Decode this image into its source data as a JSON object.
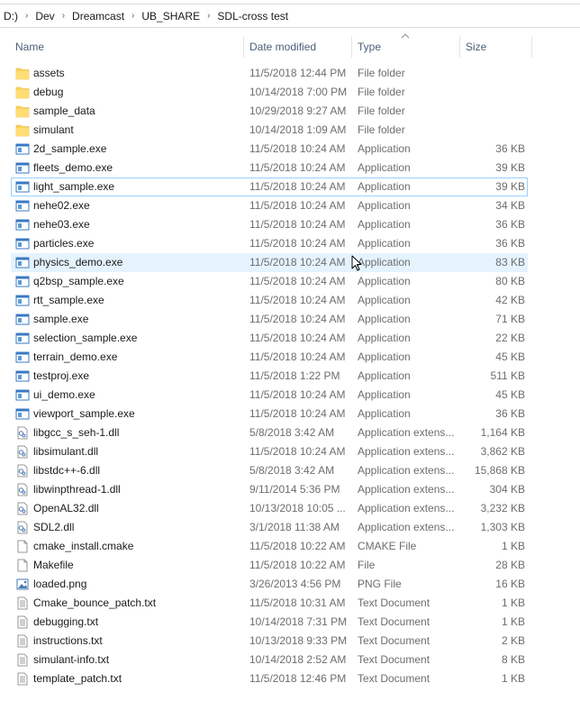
{
  "breadcrumb": [
    "D:)",
    "Dev",
    "Dreamcast",
    "UB_SHARE",
    "SDL-cross test"
  ],
  "columns": {
    "name": "Name",
    "date": "Date modified",
    "type": "Type",
    "size": "Size"
  },
  "sort": {
    "column": "type",
    "direction": "ascending"
  },
  "colors": {
    "folder": "#ffd35c",
    "header_text": "#4c607a",
    "hover_bg": "#e5f3ff",
    "focus_border": "#99d1ff"
  },
  "files": [
    {
      "name": "assets",
      "date": "11/5/2018 12:44 PM",
      "type": "File folder",
      "size": "",
      "icon": "folder-icon"
    },
    {
      "name": "debug",
      "date": "10/14/2018 7:00 PM",
      "type": "File folder",
      "size": "",
      "icon": "folder-icon"
    },
    {
      "name": "sample_data",
      "date": "10/29/2018 9:27 AM",
      "type": "File folder",
      "size": "",
      "icon": "folder-icon"
    },
    {
      "name": "simulant",
      "date": "10/14/2018 1:09 AM",
      "type": "File folder",
      "size": "",
      "icon": "folder-icon"
    },
    {
      "name": "2d_sample.exe",
      "date": "11/5/2018 10:24 AM",
      "type": "Application",
      "size": "36 KB",
      "icon": "application-icon"
    },
    {
      "name": "fleets_demo.exe",
      "date": "11/5/2018 10:24 AM",
      "type": "Application",
      "size": "39 KB",
      "icon": "application-icon"
    },
    {
      "name": "light_sample.exe",
      "date": "11/5/2018 10:24 AM",
      "type": "Application",
      "size": "39 KB",
      "icon": "application-icon",
      "state": "focused"
    },
    {
      "name": "nehe02.exe",
      "date": "11/5/2018 10:24 AM",
      "type": "Application",
      "size": "34 KB",
      "icon": "application-icon"
    },
    {
      "name": "nehe03.exe",
      "date": "11/5/2018 10:24 AM",
      "type": "Application",
      "size": "36 KB",
      "icon": "application-icon"
    },
    {
      "name": "particles.exe",
      "date": "11/5/2018 10:24 AM",
      "type": "Application",
      "size": "36 KB",
      "icon": "application-icon"
    },
    {
      "name": "physics_demo.exe",
      "date": "11/5/2018 10:24 AM",
      "type": "Application",
      "size": "83 KB",
      "icon": "application-icon",
      "state": "hovered"
    },
    {
      "name": "q2bsp_sample.exe",
      "date": "11/5/2018 10:24 AM",
      "type": "Application",
      "size": "80 KB",
      "icon": "application-icon"
    },
    {
      "name": "rtt_sample.exe",
      "date": "11/5/2018 10:24 AM",
      "type": "Application",
      "size": "42 KB",
      "icon": "application-icon"
    },
    {
      "name": "sample.exe",
      "date": "11/5/2018 10:24 AM",
      "type": "Application",
      "size": "71 KB",
      "icon": "application-icon"
    },
    {
      "name": "selection_sample.exe",
      "date": "11/5/2018 10:24 AM",
      "type": "Application",
      "size": "22 KB",
      "icon": "application-icon"
    },
    {
      "name": "terrain_demo.exe",
      "date": "11/5/2018 10:24 AM",
      "type": "Application",
      "size": "45 KB",
      "icon": "application-icon"
    },
    {
      "name": "testproj.exe",
      "date": "11/5/2018 1:22 PM",
      "type": "Application",
      "size": "511 KB",
      "icon": "application-icon"
    },
    {
      "name": "ui_demo.exe",
      "date": "11/5/2018 10:24 AM",
      "type": "Application",
      "size": "45 KB",
      "icon": "application-icon"
    },
    {
      "name": "viewport_sample.exe",
      "date": "11/5/2018 10:24 AM",
      "type": "Application",
      "size": "36 KB",
      "icon": "application-icon"
    },
    {
      "name": "libgcc_s_seh-1.dll",
      "date": "5/8/2018 3:42 AM",
      "type": "Application extens...",
      "size": "1,164 KB",
      "icon": "dll-icon"
    },
    {
      "name": "libsimulant.dll",
      "date": "11/5/2018 10:24 AM",
      "type": "Application extens...",
      "size": "3,862 KB",
      "icon": "dll-icon"
    },
    {
      "name": "libstdc++-6.dll",
      "date": "5/8/2018 3:42 AM",
      "type": "Application extens...",
      "size": "15,868 KB",
      "icon": "dll-icon"
    },
    {
      "name": "libwinpthread-1.dll",
      "date": "9/11/2014 5:36 PM",
      "type": "Application extens...",
      "size": "304 KB",
      "icon": "dll-icon"
    },
    {
      "name": "OpenAL32.dll",
      "date": "10/13/2018 10:05 ...",
      "type": "Application extens...",
      "size": "3,232 KB",
      "icon": "dll-icon"
    },
    {
      "name": "SDL2.dll",
      "date": "3/1/2018 11:38 AM",
      "type": "Application extens...",
      "size": "1,303 KB",
      "icon": "dll-icon"
    },
    {
      "name": "cmake_install.cmake",
      "date": "11/5/2018 10:22 AM",
      "type": "CMAKE File",
      "size": "1 KB",
      "icon": "blank-file-icon"
    },
    {
      "name": "Makefile",
      "date": "11/5/2018 10:22 AM",
      "type": "File",
      "size": "28 KB",
      "icon": "blank-file-icon"
    },
    {
      "name": "loaded.png",
      "date": "3/26/2013 4:56 PM",
      "type": "PNG File",
      "size": "16 KB",
      "icon": "image-file-icon"
    },
    {
      "name": "Cmake_bounce_patch.txt",
      "date": "11/5/2018 10:31 AM",
      "type": "Text Document",
      "size": "1 KB",
      "icon": "text-file-icon"
    },
    {
      "name": "debugging.txt",
      "date": "10/14/2018 7:31 PM",
      "type": "Text Document",
      "size": "1 KB",
      "icon": "text-file-icon"
    },
    {
      "name": "instructions.txt",
      "date": "10/13/2018 9:33 PM",
      "type": "Text Document",
      "size": "2 KB",
      "icon": "text-file-icon"
    },
    {
      "name": "simulant-info.txt",
      "date": "10/14/2018 2:52 AM",
      "type": "Text Document",
      "size": "8 KB",
      "icon": "text-file-icon"
    },
    {
      "name": "template_patch.txt",
      "date": "11/5/2018 12:46 PM",
      "type": "Text Document",
      "size": "1 KB",
      "icon": "text-file-icon"
    }
  ]
}
